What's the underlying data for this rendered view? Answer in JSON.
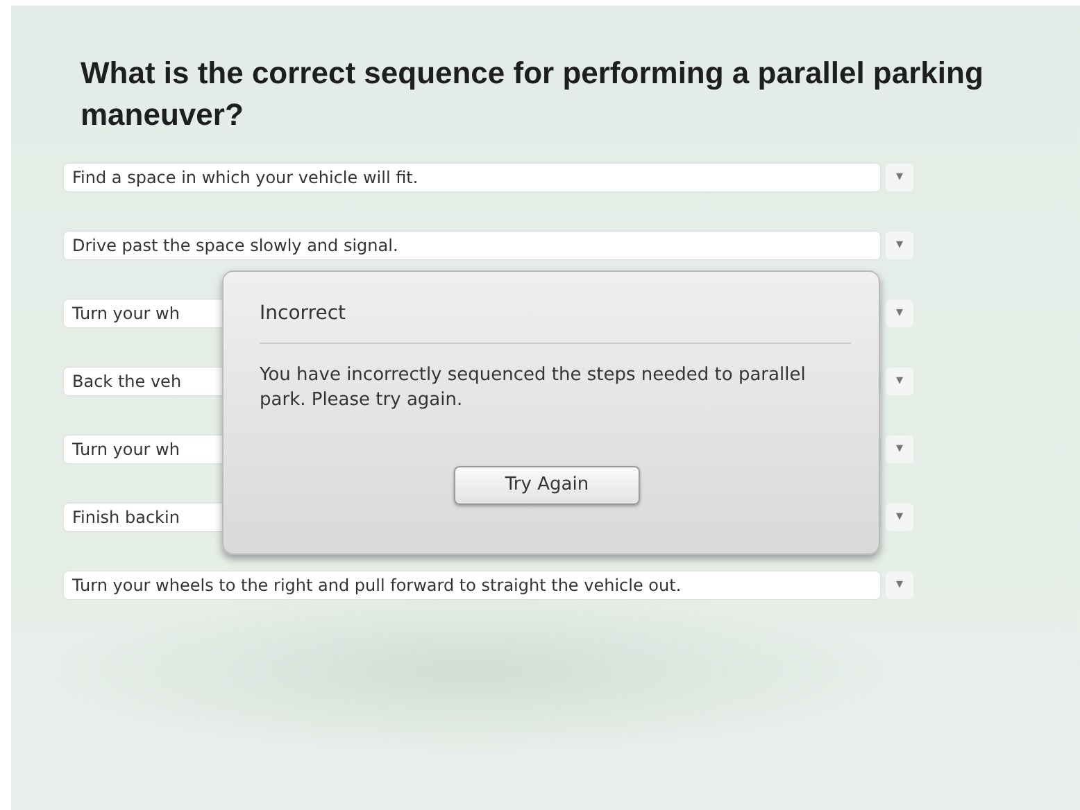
{
  "question": "What is the correct sequence for performing a parallel parking maneuver?",
  "steps": [
    {
      "text": "Find a space in which your vehicle will fit.",
      "arrow": "▾"
    },
    {
      "text": "Drive past the space slowly and signal.",
      "arrow": "▾"
    },
    {
      "text": "Turn your wh",
      "arrow": "▾"
    },
    {
      "text": "Back the veh",
      "arrow": "▾"
    },
    {
      "text": "Turn your wh",
      "arrow": "▾"
    },
    {
      "text": "Finish backin",
      "arrow": "▾"
    },
    {
      "text": "Turn your wheels to the right and pull forward to straight the vehicle out.",
      "arrow": "▾"
    }
  ],
  "dialog": {
    "title": "Incorrect",
    "message": "You have incorrectly sequenced the steps needed to parallel park. Please try again.",
    "button": "Try Again"
  }
}
